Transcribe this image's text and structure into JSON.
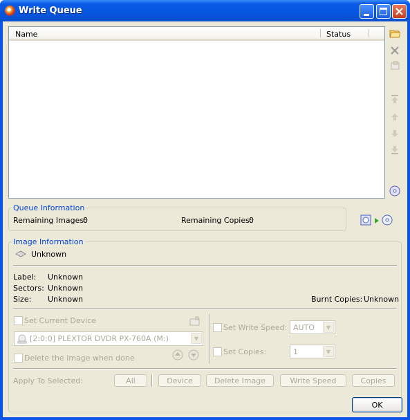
{
  "window": {
    "title": "Write Queue"
  },
  "queue_list": {
    "columns": [
      "Name",
      "Status"
    ],
    "rows": []
  },
  "side_toolbar": {
    "icons": [
      "add-image-icon",
      "remove-icon",
      "properties-icon",
      "move-top-icon",
      "move-up-icon",
      "move-down-icon",
      "move-bottom-icon",
      "disc-icon"
    ]
  },
  "queue_info": {
    "legend": "Queue Information",
    "remaining_images_label": "Remaining Images:",
    "remaining_images_value": "0",
    "remaining_copies_label": "Remaining Copies:",
    "remaining_copies_value": "0"
  },
  "image_info": {
    "legend": "Image Information",
    "name": "Unknown",
    "label_label": "Label:",
    "label_value": "Unknown",
    "sectors_label": "Sectors:",
    "sectors_value": "Unknown",
    "size_label": "Size:",
    "size_value": "Unknown",
    "burnt_copies_label": "Burnt Copies:",
    "burnt_copies_value": "Unknown"
  },
  "device": {
    "set_current_device_label": "Set Current Device",
    "device_value": "[2:0:0] PLEXTOR DVDR   PX-760A (M:)",
    "delete_when_done_label": "Delete the image when done"
  },
  "write": {
    "set_write_speed_label": "Set Write Speed:",
    "write_speed_value": "AUTO",
    "set_copies_label": "Set Copies:",
    "copies_value": "1"
  },
  "apply": {
    "label": "Apply To Selected:",
    "all": "All",
    "device": "Device",
    "delete_image": "Delete Image",
    "write_speed": "Write Speed",
    "copies": "Copies"
  },
  "ok_button": "OK",
  "colors": {
    "title_bar": "#0a5ae6",
    "client_bg": "#ece9d8",
    "group_legend": "#0046d5"
  }
}
